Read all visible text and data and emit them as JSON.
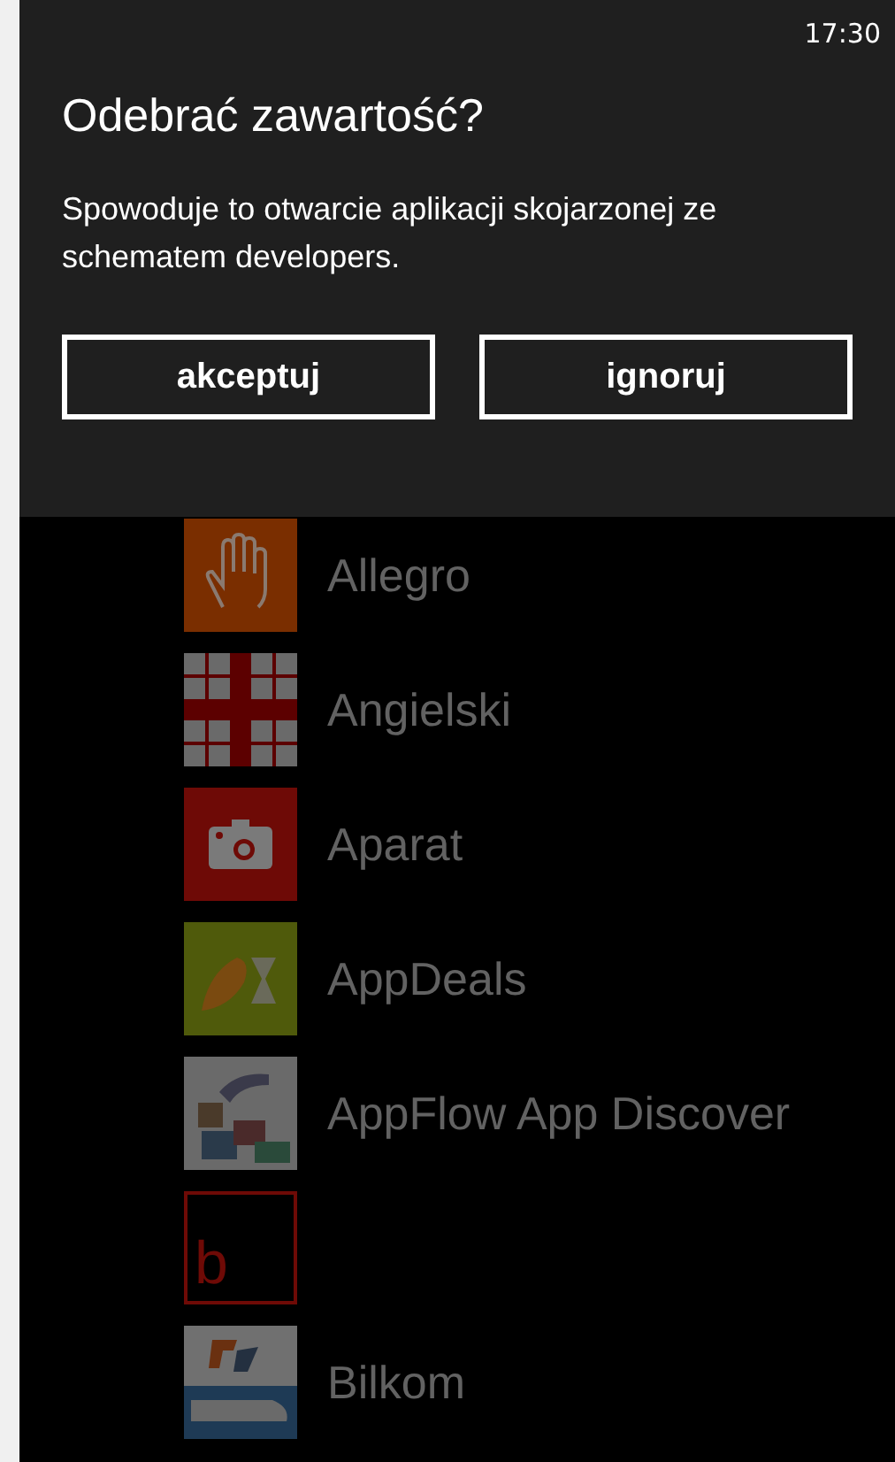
{
  "status_bar": {
    "time": "17:30"
  },
  "dialog": {
    "title": "Odebrać zawartość?",
    "message": "Spowoduje to otwarcie aplikacji skojarzonej ze schematem developers.",
    "buttons": [
      "akceptuj",
      "ignoruj"
    ]
  },
  "apps": [
    {
      "name": "Allegro",
      "kind": "hand",
      "color": "#7a2e00"
    },
    {
      "name": "Angielski",
      "kind": "grid",
      "color": "#5c0000"
    },
    {
      "name": "Aparat",
      "kind": "camera",
      "color": "#6e0a06"
    },
    {
      "name": "AppDeals",
      "kind": "deals",
      "color": "#4f5a0b"
    },
    {
      "name": "AppFlow App Discover",
      "kind": "collage",
      "color": "#6a6a6a"
    },
    {
      "kind": "letter",
      "letter": "b",
      "color": "#6e0a06"
    },
    {
      "name": "Bilkom",
      "kind": "train",
      "color": "#5a5a5a"
    }
  ]
}
